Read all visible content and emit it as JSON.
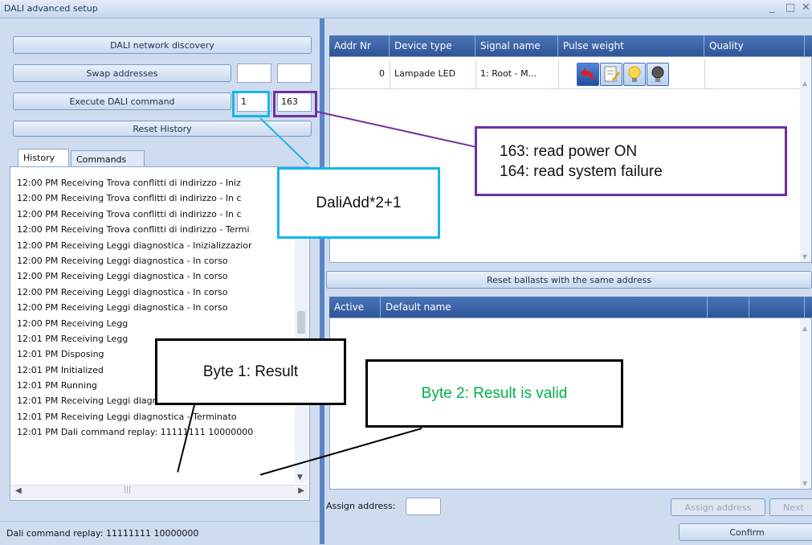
{
  "window": {
    "title": "DALI advanced setup"
  },
  "left": {
    "discovery_button": "DALI network discovery",
    "swap_button": "Swap addresses",
    "execute_button": "Execute DALI command",
    "execute_value1": "1",
    "execute_value2": "163",
    "reset_history_button": "Reset History",
    "tabs": [
      "History",
      "Commands"
    ],
    "history": [
      "12:00 PM Receiving Trova conflitti di indirizzo - Iniz",
      "12:00 PM Receiving Trova conflitti di indirizzo - In c",
      "12:00 PM Receiving Trova conflitti di indirizzo - In c",
      "12:00 PM Receiving Trova conflitti di indirizzo - Termi",
      "12:00 PM Receiving Leggi diagnostica - Inizializzazior",
      "12:00 PM Receiving Leggi diagnostica - In corso",
      "12:00 PM Receiving Leggi diagnostica - In corso",
      "12:00 PM Receiving Leggi diagnostica - In corso",
      "12:00 PM Receiving Leggi diagnostica - In corso",
      "12:00 PM Receiving Legg",
      "12:01 PM Receiving Legg",
      "12:01 PM Disposing",
      "12:01 PM Initialized",
      "12:01 PM Running",
      "12:01 PM Receiving Leggi diagnostica - Inizializzazior",
      "12:01 PM Receiving Leggi diagnostica - Terminato",
      "12:01 PM Dali command replay: 11111111 10000000"
    ],
    "status": "Dali command replay: 11111111 10000000"
  },
  "grid1": {
    "headers": [
      "Addr Nr",
      "Device type",
      "Signal name",
      "Pulse weight",
      "Quality"
    ],
    "row": {
      "addr": "0",
      "device_type": "Lampade LED",
      "signal_name": "1: Root - M..."
    },
    "icons": [
      "undo-arrow-icon",
      "edit-note-icon",
      "bulb-on-icon",
      "bulb-off-icon"
    ]
  },
  "reset_ballasts_button": "Reset ballasts with the same address",
  "grid2": {
    "headers": [
      "Active",
      "Default name"
    ]
  },
  "assign": {
    "label": "Assign address:",
    "button": "Assign address",
    "next": "Next"
  },
  "confirm_button": "Confirm",
  "callouts": {
    "read": [
      "163: read power ON",
      "164: read system failure"
    ],
    "formula": "DaliAdd*2+1",
    "byte1": "Byte 1: Result",
    "byte2": "Byte 2: Result is valid"
  },
  "colors": {
    "purple": "#7030a0",
    "cyan": "#16b6ea",
    "green": "#00b050",
    "header": "#2f5597"
  }
}
